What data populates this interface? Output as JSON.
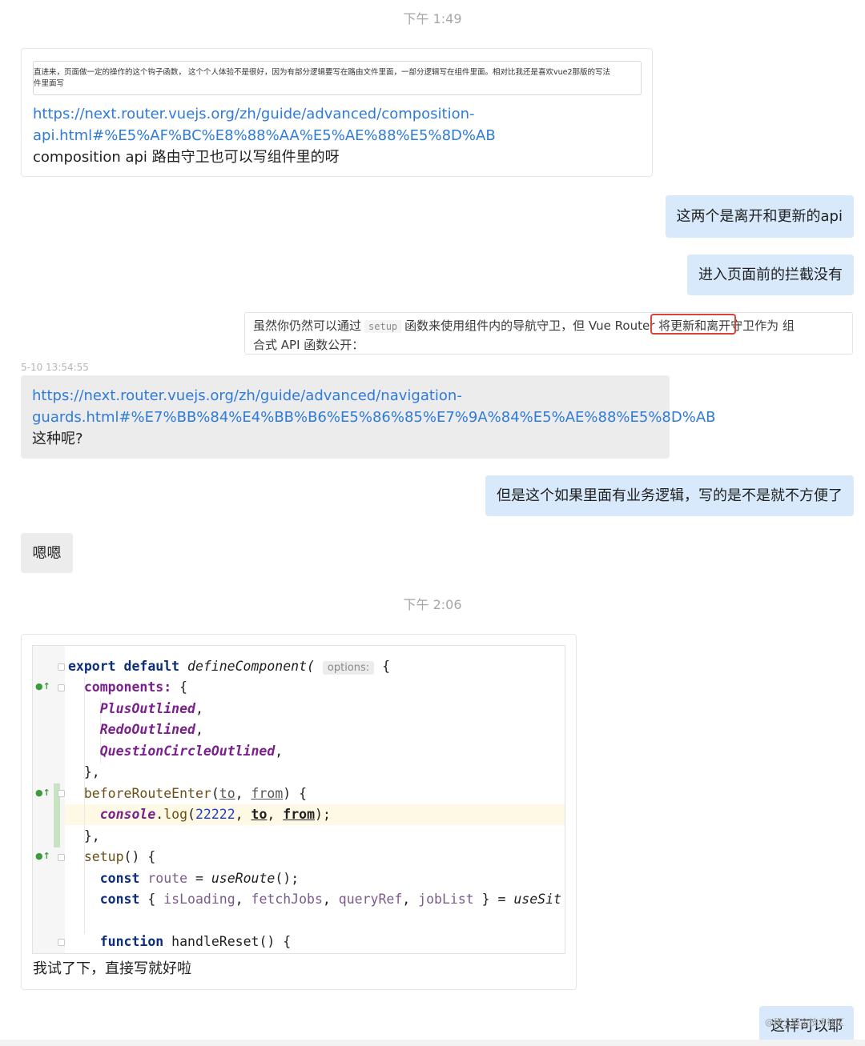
{
  "timestamps": {
    "first": "下午 1:49",
    "inline_log": "5-10 13:54:55",
    "second": "下午 2:06"
  },
  "messages": {
    "m1": {
      "quote_line1": "直进来，页面做一定的操作的这个钩子函数， 这个个人体验不是很好，因为有部分逻辑要写在路由文件里面，一部分逻辑写在组件里面。相对比我还是喜欢vue2那版的写法",
      "quote_line2": "件里面写",
      "link_line1": "https://next.router.vuejs.org/zh/guide/advanced/composition-",
      "link_line2": "api.html#%E5%AF%BC%E8%88%AA%E5%AE%88%E5%8D%AB",
      "text": "composition api 路由守卫也可以写组件里的呀"
    },
    "m2": {
      "text": "这两个是离开和更新的api"
    },
    "m3": {
      "text": "进入页面前的拦截没有"
    },
    "doc_card": {
      "line1_part1": "虽然你仍然可以通过",
      "code": "setup",
      "line1_part2": "函数来使用组件内的导航守卫，但 Vue Router 将更新和离开守卫作为 组",
      "line2": "合式 API 函数公开："
    },
    "m4": {
      "link_line1": "https://next.router.vuejs.org/zh/guide/advanced/navigation-",
      "link_line2": "guards.html#%E7%BB%84%E4%BB%B6%E5%86%85%E7%9A%84%E5%AE%88%E5%8D%AB",
      "text": "这种呢?"
    },
    "m5": {
      "text": "但是这个如果里面有业务逻辑，写的是不是就不方便了"
    },
    "m6": {
      "text": "嗯嗯"
    },
    "m7": {
      "caption": "我试了下，直接写就好啦",
      "code": {
        "l1_kw": "export default",
        "l1_fn": "defineComponent(",
        "l1_hint": "options:",
        "l1_end": "{",
        "l2_prop": "components:",
        "l2_end": "{",
        "l3": "PlusOutlined",
        "l4": "RedoOutlined",
        "l5": "QuestionCircleOutlined",
        "l6": "},",
        "l7_method": "beforeRouteEnter",
        "l7_p1": "to",
        "l7_p2": "from",
        "l7_end": ") {",
        "l8_obj": "console",
        "l8_method": "log",
        "l8_num": "22222",
        "l8_p1": "to",
        "l8_p2": "from",
        "l8_end": ");",
        "l9": "},",
        "l10_method": "setup",
        "l10_end": "() {",
        "l11_kw": "const",
        "l11_var": "route",
        "l11_fn": "useRoute",
        "l11_end": "();",
        "l12_kw": "const",
        "l12_v1": "isLoading",
        "l12_v2": "fetchJobs",
        "l12_v3": "queryRef",
        "l12_v4": "jobList",
        "l12_fn": "useSit",
        "l14_kw": "function",
        "l14_name": "handleReset",
        "l14_end": "() {"
      }
    },
    "m8": {
      "text": "这样可以耶"
    }
  },
  "watermark": "@稀土掘金技术社区",
  "colors": {
    "self_bubble": "#d7e9fb",
    "other_bubble_gray": "#ececec",
    "link": "#2f7bd9",
    "highlight_box": "#d9443a"
  }
}
